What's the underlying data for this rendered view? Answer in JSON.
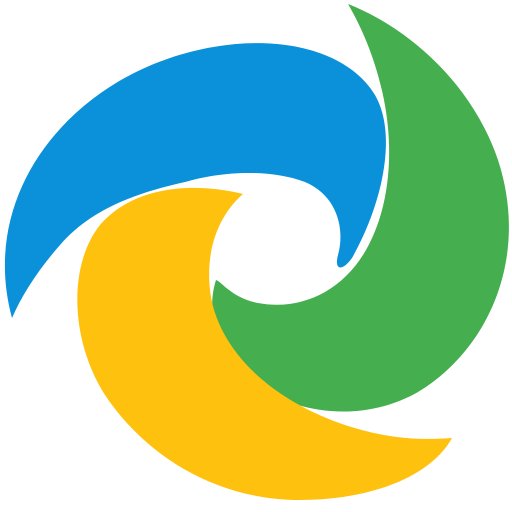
{
  "logo": {
    "icon": "swirl-logo-icon",
    "colors": {
      "blue": "#0A91D9",
      "green": "#45AE4E",
      "yellow": "#FEC10E",
      "background": "#FFFFFF"
    }
  }
}
